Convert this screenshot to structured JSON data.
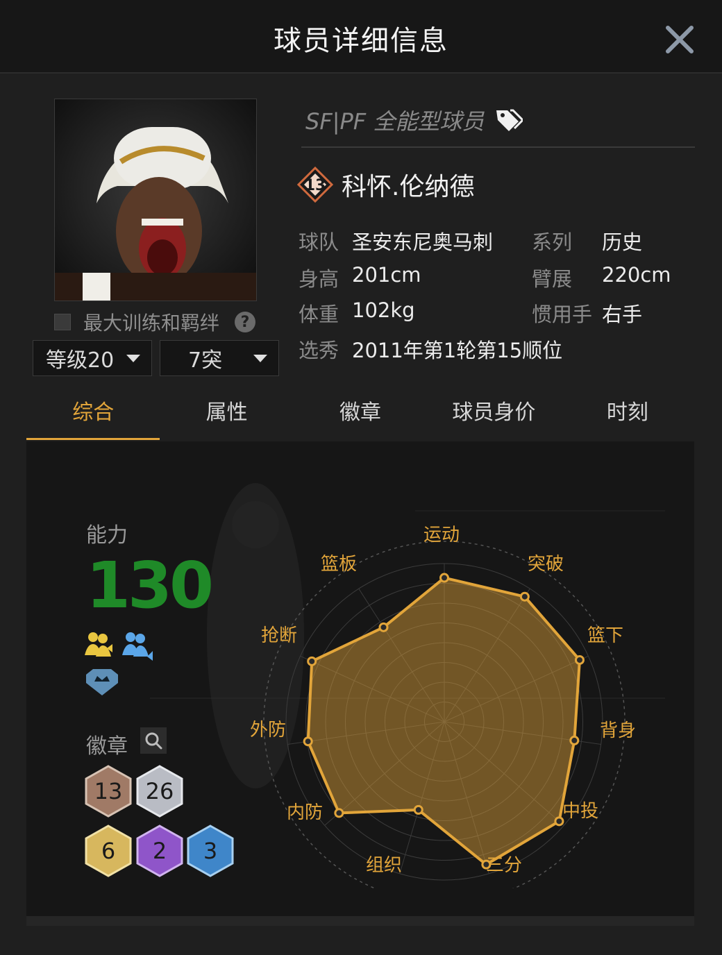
{
  "header": {
    "title": "球员详细信息"
  },
  "player": {
    "position_type": "SF|PF 全能型球员",
    "number": "13",
    "name": "科怀.伦纳德",
    "info": [
      {
        "label": "球队",
        "value": "圣安东尼奥马刺"
      },
      {
        "label": "系列",
        "value": "历史"
      },
      {
        "label": "身高",
        "value": "201cm"
      },
      {
        "label": "臂展",
        "value": "220cm"
      },
      {
        "label": "体重",
        "value": "102kg"
      },
      {
        "label": "惯用手",
        "value": "右手"
      },
      {
        "label": "选秀",
        "value": "2011年第1轮第15顺位"
      }
    ]
  },
  "controls": {
    "max_train_label": "最大训练和羁绊",
    "level": "等级20",
    "breakthrough": "7突"
  },
  "tabs": [
    "综合",
    "属性",
    "徽章",
    "球员身价",
    "时刻"
  ],
  "active_tab": "综合",
  "overview": {
    "ability_label": "能力",
    "ability_value": "130",
    "badge_label": "徽章",
    "badges": [
      {
        "count": "13",
        "tier": "bronze",
        "color": "#a07a66"
      },
      {
        "count": "26",
        "tier": "silver",
        "color": "#b9bcc4"
      },
      {
        "count": "6",
        "tier": "gold",
        "color": "#d7b75e"
      },
      {
        "count": "2",
        "tier": "purple",
        "color": "#8f55c9"
      },
      {
        "count": "3",
        "tier": "blue",
        "color": "#3f86c9"
      }
    ]
  },
  "radar": {
    "labels": [
      "运动",
      "突破",
      "篮下",
      "背身",
      "中投",
      "三分",
      "组织",
      "内防",
      "外防",
      "抢断",
      "篮板"
    ],
    "values": [
      0.91,
      0.94,
      0.94,
      0.83,
      0.96,
      0.94,
      0.58,
      0.88,
      0.87,
      0.92,
      0.71
    ],
    "color": "#e2a53a"
  }
}
